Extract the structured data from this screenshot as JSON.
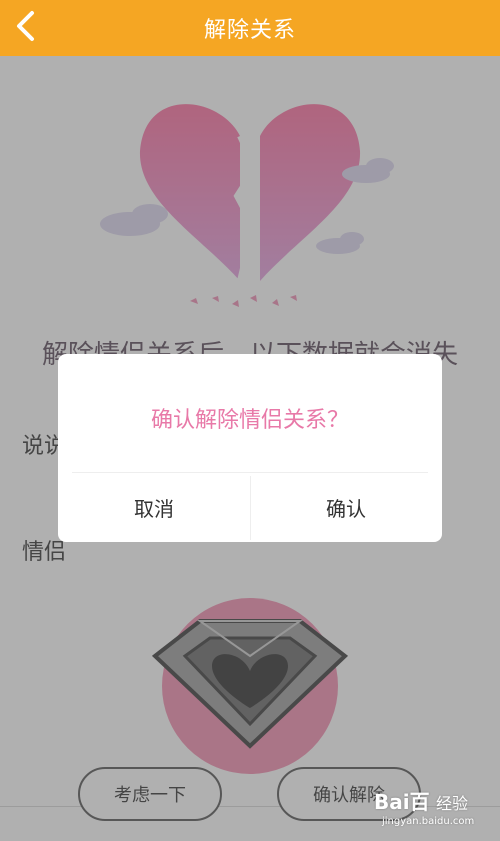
{
  "header": {
    "title": "解除关系",
    "back_icon": "chevron-left-icon",
    "background_color": "#f5a623"
  },
  "content": {
    "heading": "解除情侣关系后，以下数据就会消失",
    "row1_label": "说说",
    "row2_label": "情侣",
    "illustrations": [
      "broken-heart-icon",
      "diamond-ring-icon"
    ]
  },
  "buttons": {
    "consider": "考虑一下",
    "confirm_dissolve": "确认解除"
  },
  "dialog": {
    "message": "确认解除情侣关系？",
    "cancel": "取消",
    "confirm": "确认",
    "message_color": "#e879a8"
  },
  "watermark": {
    "logo": "Bai百",
    "sub": "jingyan.baidu.com",
    "text": "经验"
  }
}
